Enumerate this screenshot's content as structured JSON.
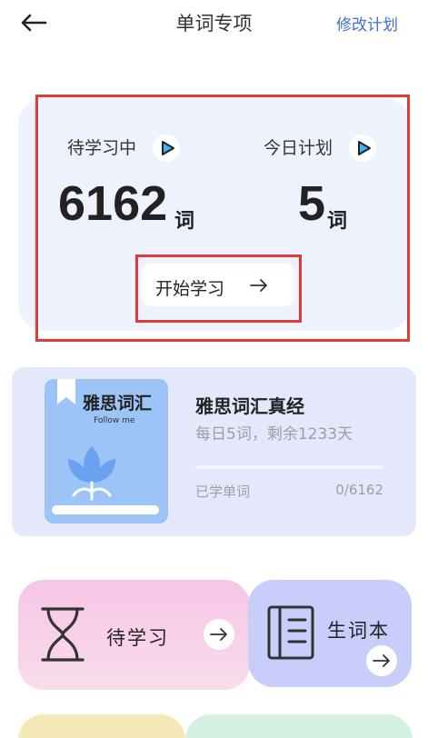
{
  "header": {
    "title": "单词专项",
    "modify_plan": "修改计划",
    "back_icon": "arrow-left-icon"
  },
  "study": {
    "pending_label": "待学习中",
    "pending_count": "6162",
    "pending_unit": "词",
    "today_label": "今日计划",
    "today_count": "5",
    "today_unit": "词",
    "start_label": "开始学习",
    "play_icon": "play-icon"
  },
  "book": {
    "cover_title": "雅思词汇",
    "cover_subtitle": "Follow me",
    "name": "雅思词汇真经",
    "daily": "每日5词，剩余1233天",
    "learned_label": "已学单词",
    "learned_count": "0/6162",
    "progress_fraction": 0
  },
  "tiles": {
    "pending": {
      "label": "待学习",
      "icon": "hourglass-icon"
    },
    "vocab": {
      "label": "生词本",
      "icon": "notebook-icon"
    }
  },
  "colors": {
    "accent": "#3f6fd1",
    "highlight_box": "#e23a3a"
  }
}
